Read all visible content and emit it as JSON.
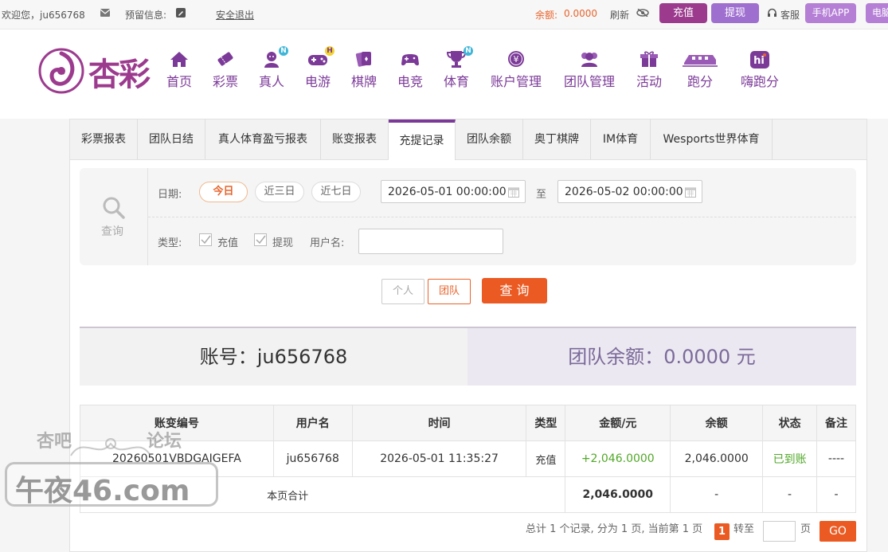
{
  "topbar": {
    "welcome": "欢迎您，ju656768",
    "reserve_info": "预留信息:",
    "logout": "安全退出",
    "balance_label": "余额:",
    "balance_value": "0.0000",
    "refresh": "刷新",
    "deposit": "充值",
    "withdraw": "提现",
    "service": "客服",
    "mobile_app": "手机APP",
    "pc": "电脑"
  },
  "logo": {
    "text": "杏彩"
  },
  "nav": [
    {
      "label": "首页",
      "icon": "home-icon"
    },
    {
      "label": "彩票",
      "icon": "lottery-ticket-icon"
    },
    {
      "label": "真人",
      "icon": "live-dealer-icon",
      "badge": "N"
    },
    {
      "label": "电游",
      "icon": "gamepad-icon",
      "badge": "H"
    },
    {
      "label": "棋牌",
      "icon": "cards-icon"
    },
    {
      "label": "电竞",
      "icon": "esports-controller-icon"
    },
    {
      "label": "体育",
      "icon": "trophy-icon",
      "badge": "N"
    },
    {
      "label": "账户管理",
      "icon": "yen-coin-icon"
    },
    {
      "label": "团队管理",
      "icon": "team-icon"
    },
    {
      "label": "活动",
      "icon": "gift-icon"
    },
    {
      "label": "跑分",
      "icon": "train-icon"
    },
    {
      "label": "嗨跑分",
      "icon": "hi-icon"
    }
  ],
  "tabs": [
    {
      "label": "彩票报表"
    },
    {
      "label": "团队日结"
    },
    {
      "label": "真人体育盈亏报表"
    },
    {
      "label": "账变报表"
    },
    {
      "label": "充提记录",
      "active": true
    },
    {
      "label": "团队余额"
    },
    {
      "label": "奥丁棋牌"
    },
    {
      "label": "IM体育"
    },
    {
      "label": "Wesports世界体育"
    }
  ],
  "filter": {
    "query_label": "查询",
    "date_label": "日期:",
    "quick_dates": [
      "今日",
      "近三日",
      "近七日"
    ],
    "start_date": "2026-05-01 00:00:00",
    "to_label": "至",
    "end_date": "2026-05-02 00:00:00",
    "type_label": "类型:",
    "types": [
      "充值",
      "提现"
    ],
    "username_label": "用户名:",
    "username_value": "",
    "btn_personal": "个人",
    "btn_team": "团队",
    "btn_query": "查 询"
  },
  "summary": {
    "account_label": "账号：",
    "account_value": "ju656768",
    "team_balance_label": "团队余额：",
    "team_balance_value": "0.0000 元"
  },
  "table": {
    "headers": [
      "账变编号",
      "用户名",
      "时间",
      "类型",
      "金额/元",
      "余额",
      "状态",
      "备注"
    ],
    "rows": [
      [
        "20260501VBDGAIGEFA",
        "ju656768",
        "2026-05-01 11:35:27",
        "充值",
        "+2,046.0000",
        "2,046.0000",
        "已到账",
        "----"
      ]
    ],
    "total_row": {
      "label": "本页合计",
      "amount": "2,046.0000",
      "balance": "-",
      "status": "-",
      "note": "-"
    }
  },
  "pager": {
    "summary": "总计 1 个记录, 分为 1 页, 当前第 1 页",
    "current": "1",
    "goto_label": "转至",
    "page_label": "页",
    "go": "GO"
  },
  "watermark": {
    "line1": "杏吧",
    "line2": "论坛",
    "line3": "午夜46.com"
  },
  "colors": {
    "brand_purple": "#7c3a98",
    "accent_orange": "#e8642c",
    "green": "#52a829"
  }
}
